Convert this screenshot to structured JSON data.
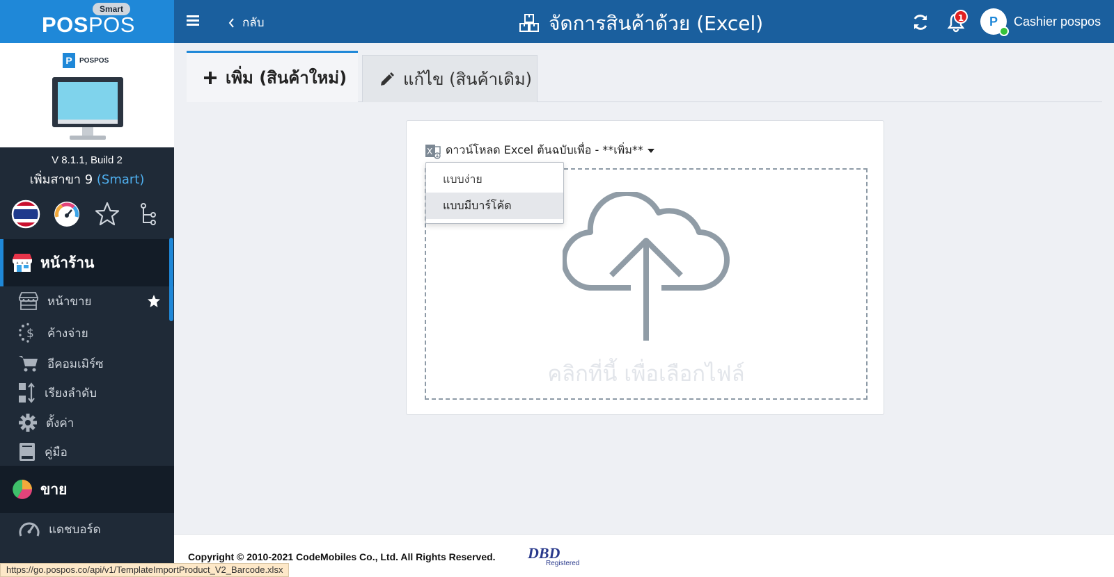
{
  "brand": {
    "badge": "Smart",
    "logo_bold": "POS",
    "logo_thin": "POS"
  },
  "header": {
    "back_label": "กลับ",
    "title": "จัดการสินค้าด้วย (Excel)",
    "notification_count": "1",
    "user_name": "Cashier pospos"
  },
  "sidebar": {
    "mini_logo_text": "POSPOS",
    "version": "V 8.1.1, Build 2",
    "branch_name": "เพิ่มสาขา 9",
    "branch_plan": "(Smart)",
    "section_store": "หน้าร้าน",
    "items": [
      {
        "label": "หน้าขาย",
        "icon": "storefront-icon"
      },
      {
        "label": "ค้างจ่าย",
        "icon": "dollar-dots-icon"
      },
      {
        "label": "อีคอมเมิร์ซ",
        "icon": "cart-icon"
      },
      {
        "label": "เรียงลำดับ",
        "icon": "sort-icon"
      },
      {
        "label": "ตั้งค่า",
        "icon": "gear-icon"
      },
      {
        "label": "คู่มือ",
        "icon": "book-icon"
      }
    ],
    "section_sales": "ขาย",
    "dashboard_label": "แดชบอร์ด"
  },
  "tabs": {
    "add_label": "เพิ่ม (สินค้าใหม่)",
    "edit_label": "แก้ไข (สินค้าเดิม)"
  },
  "upload": {
    "download_label": "ดาวน์โหลด Excel ต้นฉบับเพื่อ - **เพิ่ม**",
    "options": [
      "แบบง่าย",
      "แบบมีบาร์โค้ด"
    ],
    "drop_hint": "คลิกที่นี้ เพื่อเลือกไฟล์"
  },
  "footer": {
    "copyright": "Copyright © 2010-2021 CodeMobiles Co., Ltd. All Rights Reserved.",
    "dbd_mark": "DBD",
    "dbd_registered": "Registered"
  },
  "status_url": "https://go.pospos.co/api/v1/TemplateImportProduct_V2_Barcode.xlsx",
  "colors": {
    "topbar": "#1a5f9e",
    "brand": "#1f88d8",
    "sidebar": "#1f2a37",
    "accent": "#1f88d8",
    "badge": "#e02020"
  }
}
